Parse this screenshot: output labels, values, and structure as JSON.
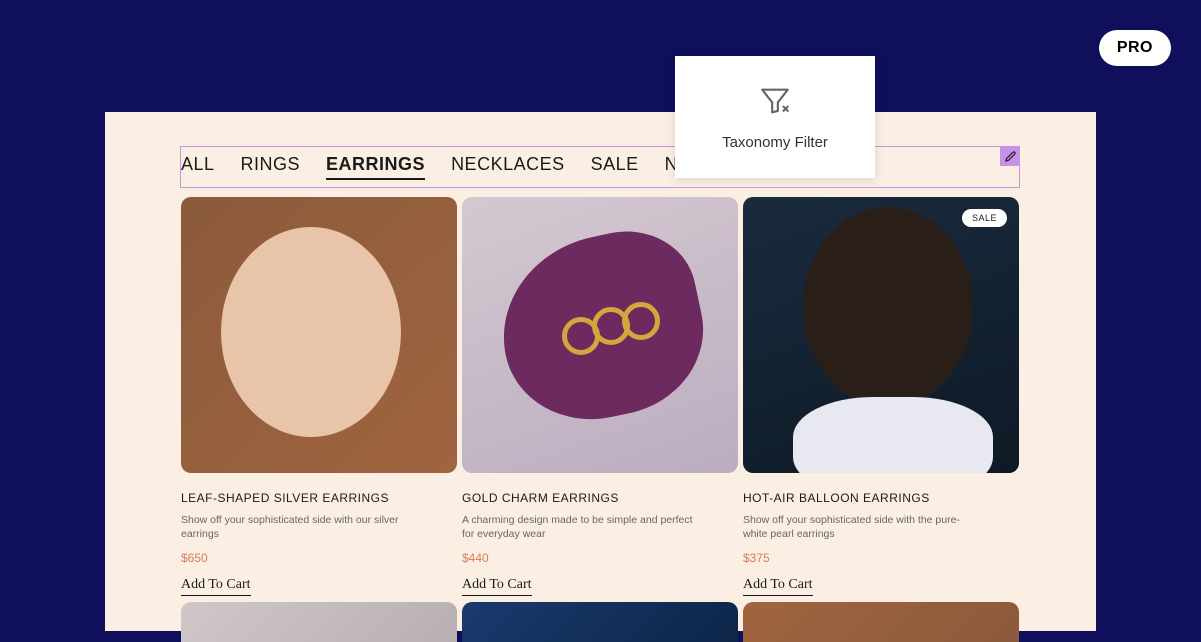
{
  "pro_badge": "PRO",
  "tooltip": {
    "label": "Taxonomy Filter"
  },
  "filter_tabs": {
    "items": [
      {
        "label": "ALL",
        "active": false
      },
      {
        "label": "RINGS",
        "active": false
      },
      {
        "label": "EARRINGS",
        "active": true
      },
      {
        "label": "NECKLACES",
        "active": false
      },
      {
        "label": "SALE",
        "active": false
      },
      {
        "label": "NEW",
        "active": false
      }
    ]
  },
  "products": [
    {
      "title": "LEAF-SHAPED SILVER EARRINGS",
      "description": "Show off your sophisticated side with our silver earrings",
      "price": "$650",
      "cta": "Add To Cart",
      "sale": false
    },
    {
      "title": "GOLD CHARM EARRINGS",
      "description": "A charming design made to be simple and perfect for everyday wear",
      "price": "$440",
      "cta": "Add To Cart",
      "sale": false
    },
    {
      "title": "HOT-AIR BALLOON EARRINGS",
      "description": "Show off your sophisticated side with the pure-white pearl earrings",
      "price": "$375",
      "cta": "Add To Cart",
      "sale": true,
      "sale_label": "SALE"
    }
  ]
}
